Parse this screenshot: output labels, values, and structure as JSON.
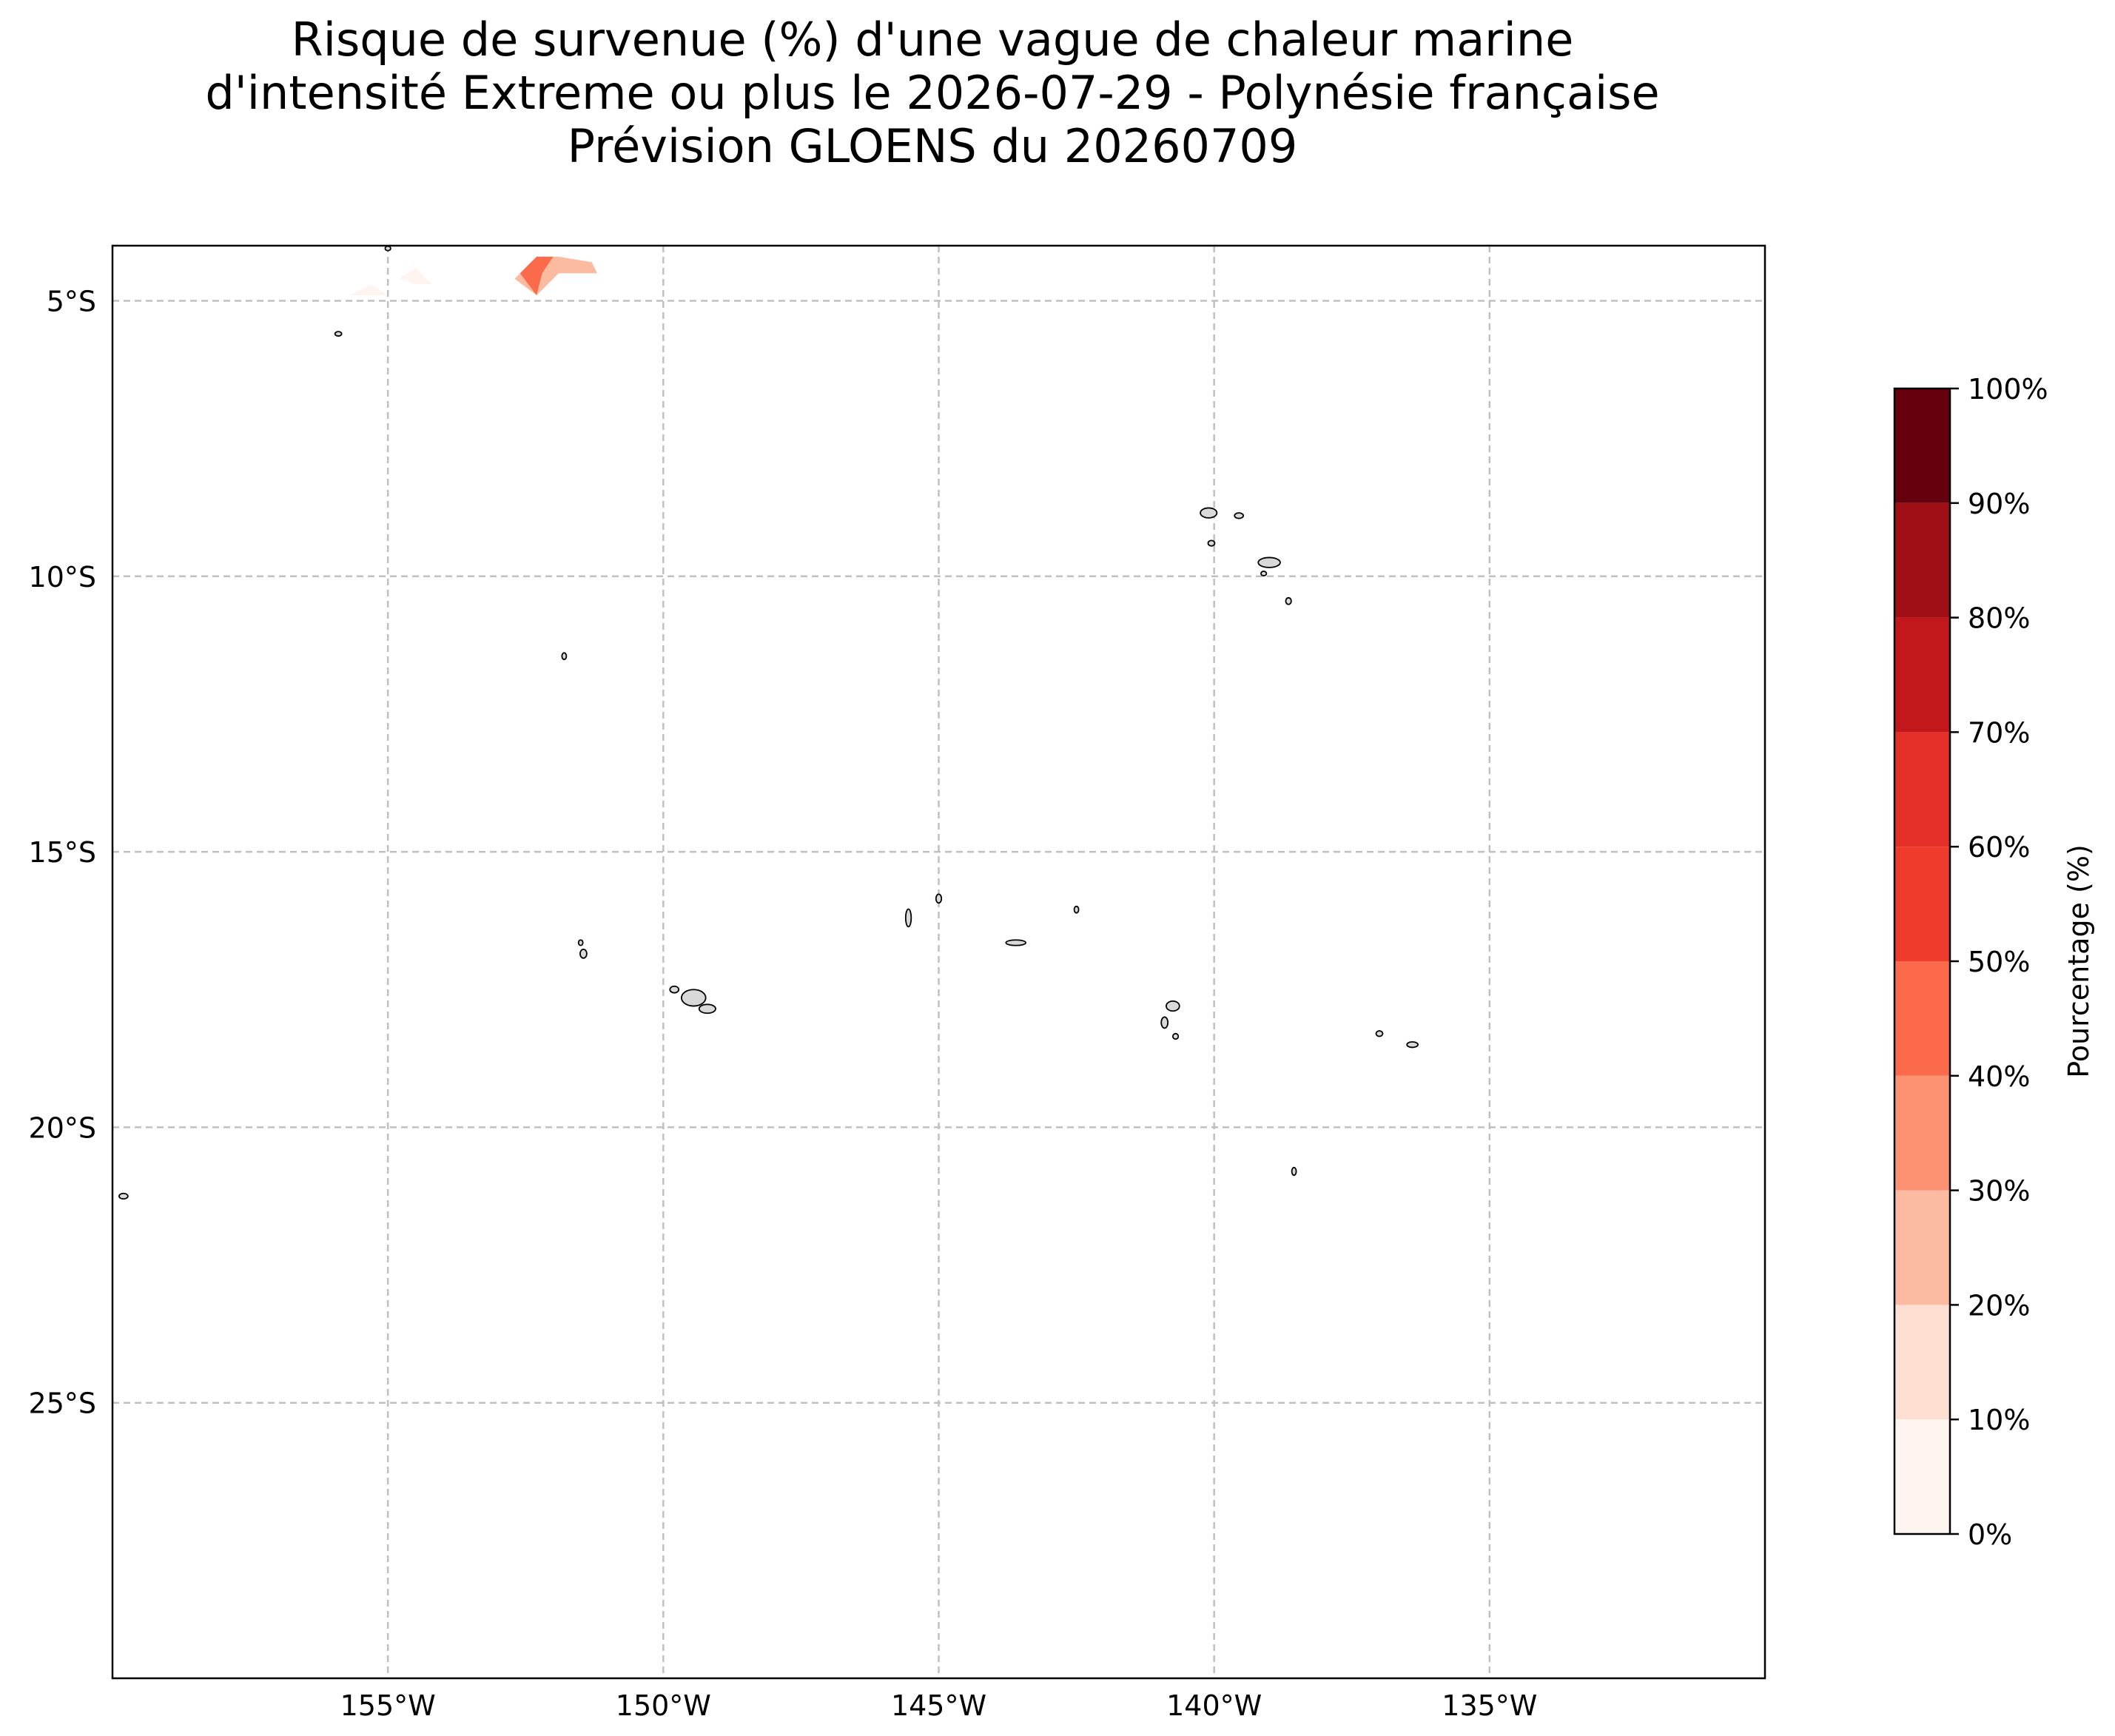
{
  "title": {
    "line1": "Risque de survenue (%) d'une vague de chaleur marine",
    "line2": "d'intensité Extreme ou plus le 2026-07-29 - Polynésie française",
    "line3": "Prévision GLOENS du 20260709"
  },
  "map": {
    "region": "Polynésie française",
    "lon_range": [
      -160,
      -130
    ],
    "lat_range": [
      -30,
      -4
    ],
    "lon_ticks": [
      {
        "value": -155,
        "label": "155°W"
      },
      {
        "value": -150,
        "label": "150°W"
      },
      {
        "value": -145,
        "label": "145°W"
      },
      {
        "value": -140,
        "label": "140°W"
      },
      {
        "value": -135,
        "label": "135°W"
      }
    ],
    "lat_ticks": [
      {
        "value": -5,
        "label": "5°S"
      },
      {
        "value": -10,
        "label": "10°S"
      },
      {
        "value": -15,
        "label": "15°S"
      },
      {
        "value": -20,
        "label": "20°S"
      },
      {
        "value": -25,
        "label": "25°S"
      }
    ],
    "gridlines": "dashed",
    "land_color": "#d9d9d9",
    "risk_patches": [
      {
        "lon": [
          -152.7,
          -152.3,
          -151.9,
          -151.3,
          -151.2,
          -151.9,
          -152.2,
          -152.3,
          -152.7
        ],
        "lat": [
          -4.6,
          -4.2,
          -4.2,
          -4.3,
          -4.5,
          -4.5,
          -4.8,
          -4.9,
          -4.6
        ],
        "level": 25
      },
      {
        "lon": [
          -152.6,
          -152.3,
          -152.0,
          -152.2,
          -152.3,
          -152.6
        ],
        "lat": [
          -4.5,
          -4.2,
          -4.2,
          -4.5,
          -4.9,
          -4.5
        ],
        "level": 45
      },
      {
        "lon": [
          -155.7,
          -155.3,
          -155.0,
          -155.3
        ],
        "lat": [
          -4.9,
          -4.7,
          -4.9,
          -4.9
        ],
        "level": 5
      },
      {
        "lon": [
          -154.8,
          -154.5,
          -154.2,
          -154.5
        ],
        "lat": [
          -4.6,
          -4.4,
          -4.7,
          -4.7
        ],
        "level": 5
      }
    ],
    "islands": [
      {
        "lon": -155.0,
        "lat": -4.05,
        "rx": 0.05,
        "ry": 0.03
      },
      {
        "lon": -155.9,
        "lat": -5.6,
        "rx": 0.06,
        "ry": 0.03
      },
      {
        "lon": -140.1,
        "lat": -8.85,
        "rx": 0.15,
        "ry": 0.09
      },
      {
        "lon": -139.55,
        "lat": -8.9,
        "rx": 0.08,
        "ry": 0.05
      },
      {
        "lon": -140.05,
        "lat": -9.4,
        "rx": 0.06,
        "ry": 0.05
      },
      {
        "lon": -139.0,
        "lat": -9.75,
        "rx": 0.2,
        "ry": 0.09
      },
      {
        "lon": -139.1,
        "lat": -9.95,
        "rx": 0.05,
        "ry": 0.04
      },
      {
        "lon": -138.65,
        "lat": -10.45,
        "rx": 0.05,
        "ry": 0.06
      },
      {
        "lon": -151.8,
        "lat": -11.45,
        "rx": 0.03,
        "ry": 0.06
      },
      {
        "lon": -151.5,
        "lat": -16.65,
        "rx": 0.04,
        "ry": 0.05
      },
      {
        "lon": -151.45,
        "lat": -16.85,
        "rx": 0.06,
        "ry": 0.08
      },
      {
        "lon": -149.8,
        "lat": -17.5,
        "rx": 0.08,
        "ry": 0.06
      },
      {
        "lon": -149.45,
        "lat": -17.65,
        "rx": 0.22,
        "ry": 0.15
      },
      {
        "lon": -149.2,
        "lat": -17.85,
        "rx": 0.15,
        "ry": 0.08
      },
      {
        "lon": -145.55,
        "lat": -16.2,
        "rx": 0.05,
        "ry": 0.16
      },
      {
        "lon": -145.0,
        "lat": -15.85,
        "rx": 0.05,
        "ry": 0.08
      },
      {
        "lon": -142.5,
        "lat": -16.05,
        "rx": 0.03,
        "ry": 0.06
      },
      {
        "lon": -143.6,
        "lat": -16.65,
        "rx": 0.18,
        "ry": 0.05
      },
      {
        "lon": -140.75,
        "lat": -17.8,
        "rx": 0.12,
        "ry": 0.09
      },
      {
        "lon": -140.9,
        "lat": -18.1,
        "rx": 0.06,
        "ry": 0.1
      },
      {
        "lon": -140.7,
        "lat": -18.35,
        "rx": 0.05,
        "ry": 0.05
      },
      {
        "lon": -137.0,
        "lat": -18.3,
        "rx": 0.06,
        "ry": 0.05
      },
      {
        "lon": -136.4,
        "lat": -18.5,
        "rx": 0.1,
        "ry": 0.05
      },
      {
        "lon": -138.55,
        "lat": -20.8,
        "rx": 0.04,
        "ry": 0.07
      },
      {
        "lon": -159.8,
        "lat": -21.25,
        "rx": 0.08,
        "ry": 0.05
      }
    ]
  },
  "colorbar": {
    "label": "Pourcentage (%)",
    "levels": [
      0,
      10,
      20,
      30,
      40,
      50,
      60,
      70,
      80,
      90,
      100
    ],
    "tick_labels": [
      "0%",
      "10%",
      "20%",
      "30%",
      "40%",
      "50%",
      "60%",
      "70%",
      "80%",
      "90%",
      "100%"
    ],
    "colors": [
      "#fff5f0",
      "#fee0d2",
      "#fcbba1",
      "#fc9272",
      "#fb6a4a",
      "#ef3b2c",
      "#e32f27",
      "#c2181c",
      "#9f0f16",
      "#67000d"
    ]
  }
}
